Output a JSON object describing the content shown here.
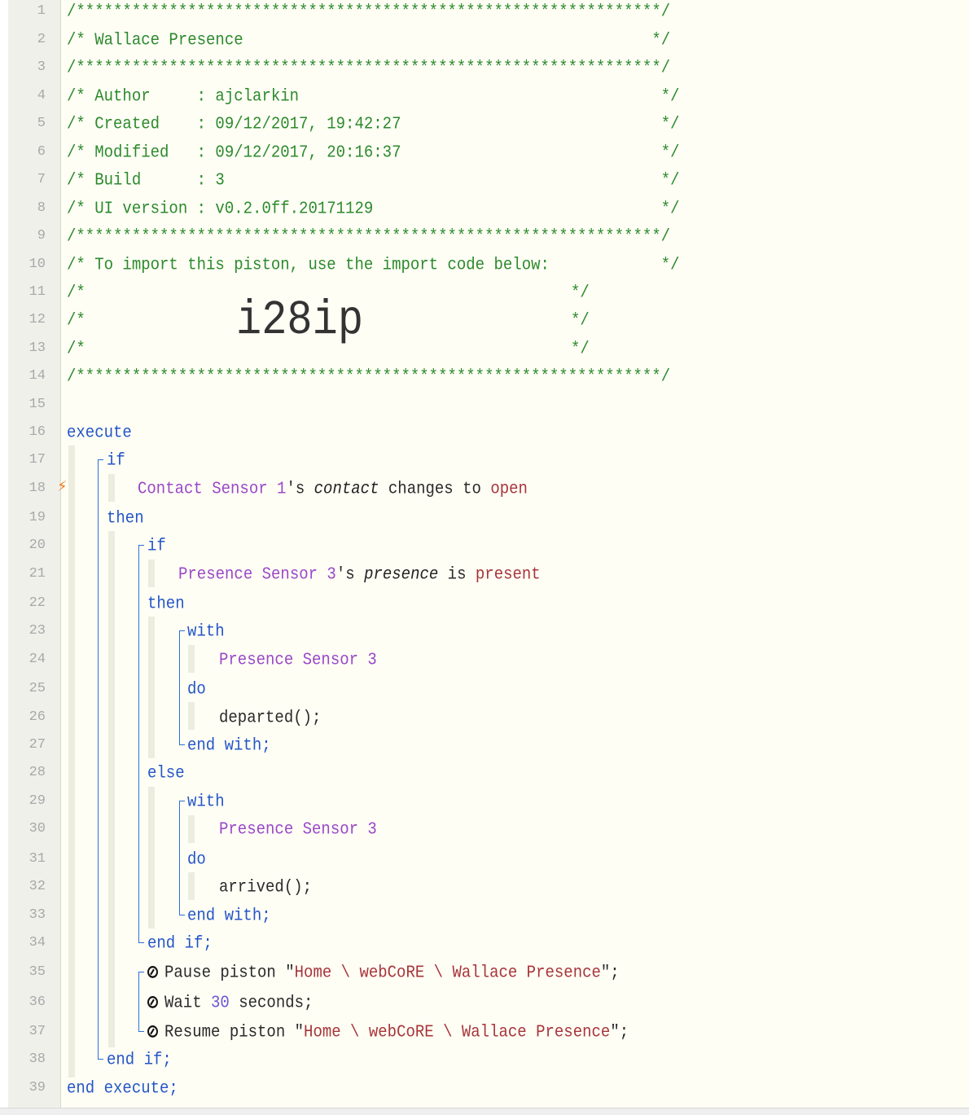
{
  "gutter": {
    "line_numbers": [
      "1",
      "2",
      "3",
      "4",
      "5",
      "6",
      "7",
      "8",
      "9",
      "10",
      "11",
      "12",
      "13",
      "14",
      "15",
      "16",
      "17",
      "18",
      "19",
      "20",
      "21",
      "22",
      "23",
      "24",
      "25",
      "26",
      "27",
      "28",
      "29",
      "30",
      "31",
      "32",
      "33",
      "34",
      "35",
      "36",
      "37",
      "38",
      "39"
    ],
    "trigger_marker": "⚡"
  },
  "header": {
    "stars": "/***************************************************************/",
    "title_line": "/* Wallace Presence                                            */",
    "author_line": "/* Author     : ajclarkin                                       */",
    "created_line": "/* Created    : 09/12/2017, 19:42:27                            */",
    "modified_line": "/* Modified   : 09/12/2017, 20:16:37                            */",
    "build_line": "/* Build      : 3                                               */",
    "ui_line": "/* UI version : v0.2.0ff.20171129                               */",
    "import_line": "/* To import this piston, use the import code below:            */",
    "blank_open": "/*",
    "blank_close": "*/",
    "import_code": "i28ip"
  },
  "kw": {
    "execute": "execute",
    "if": "if",
    "then": "then",
    "else": "else",
    "with": "with",
    "do": "do",
    "end_with": "end with;",
    "end_if": "end if;",
    "end_execute": "end execute;"
  },
  "condition1": {
    "device": "Contact Sensor 1",
    "possessive": "'s ",
    "attribute": "contact",
    "operator": " changes to ",
    "value": "open"
  },
  "condition2": {
    "device": "Presence Sensor 3",
    "possessive": "'s ",
    "attribute": "presence",
    "operator": " is ",
    "value": "present"
  },
  "with1": {
    "device": "Presence Sensor 3",
    "command": "departed();"
  },
  "with2": {
    "device": "Presence Sensor 3",
    "command": "arrived();"
  },
  "pause": {
    "verb": "Pause piston ",
    "q1": "\"",
    "path": "Home \\ webCoRE \\ Wallace Presence",
    "q2": "\";"
  },
  "wait": {
    "verb": "Wait ",
    "amount": "30",
    "unit": " seconds;"
  },
  "resume": {
    "verb": "Resume piston ",
    "q1": "\"",
    "path": "Home \\ webCoRE \\ Wallace Presence",
    "q2": "\";"
  }
}
